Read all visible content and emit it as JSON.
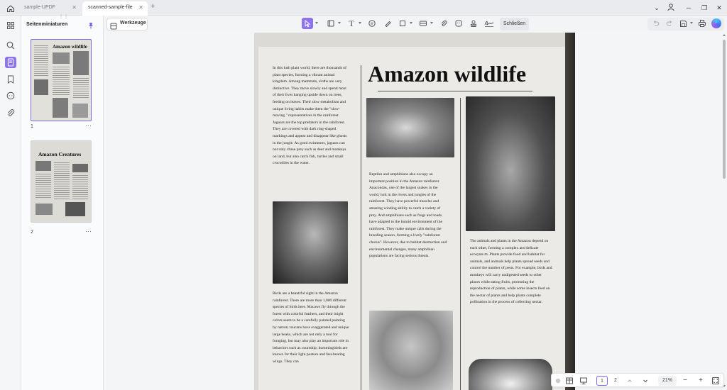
{
  "tabs": [
    {
      "label": "sample-UPDF"
    },
    {
      "label": "scanned-sample-file"
    }
  ],
  "new_tab_label": "+",
  "window_controls": {
    "collapse": "⌄",
    "account": "account",
    "minimize": "─",
    "restore": "❐",
    "close": "✕"
  },
  "sidebar_panel": {
    "title": "Seitenminiaturen",
    "pages": [
      {
        "number": "1",
        "more": "···",
        "heading": "Amazon wildlife"
      },
      {
        "number": "2",
        "more": "···",
        "heading": "Amazon Creatures"
      }
    ]
  },
  "toolbar": {
    "tools_label": "Werkzeuge",
    "close_label": "Schließen"
  },
  "document": {
    "headline": "Amazon wildlife",
    "col1_text": "In this lush plant world, there are thousands of plant species, forming a vibrant animal kingdom. Among mammals, sloths are very distinctive. They move slowly and spend most of their lives hanging upside down on trees, feeding on leaves. Their slow metabolism and unique living habits make them the \"slow-moving \" representatives in the rainforest. Jaguars are the top predators in the rainforest. They are covered with dark ring-shaped markings and appear and disappear like ghosts in the jungle. As good swimmers, jaguars can not only chase prey such as deer and monkeys on land, but also catch fish, turtles and small crocodiles in the water.",
    "col1_text2": "Birds are a beautiful sight in the Amazon rainforest. There are more than 1,000 different species of birds here. Macaws fly through the forest with colorful feathers, and their bright colors seem to be a carefully painted painting by nature; toucans have exaggerated and unique large beaks, which are not  only a tool for foraging, but may also play an important role in behaviors such as courtship; hummingbirds are known for their light posture and fast-beating wings. They can",
    "col2_text": "Reptiles and amphibians also occupy an important position in the Amazon rainforest. Anacondas, one of the largest snakes in the world, lurk in the rivers and jungles of the rainforest. They have powerful muscles and amazing winding ability to catch a variety of prey. And amphibians such as frogs and toads have adapted to the humid environment of the rainforest. They make unique calls during the breeding season, forming a lively \"rainforest chorus\". However, due to habitat destruction and environmental changes, many amphibian populations are facing serious threats.",
    "col3_text": "The animals and plants in the Amazon depend on each other, forming a complex and delicate ecosyste m. Plants provide food and habitat for animals, and animals help plants spread seeds and control the number of pests. For example, birds and monkeys will carry undigested seeds to other places while eating fruits, promoting the reproduction of plants, while some insects feed on the nectar of plants and help plants complete pollination in the process of collecting nectar."
  },
  "bottom_bar": {
    "page_current": "1",
    "page_total": "2",
    "zoom": "21%",
    "zoom_out": "−",
    "zoom_in": "+"
  }
}
